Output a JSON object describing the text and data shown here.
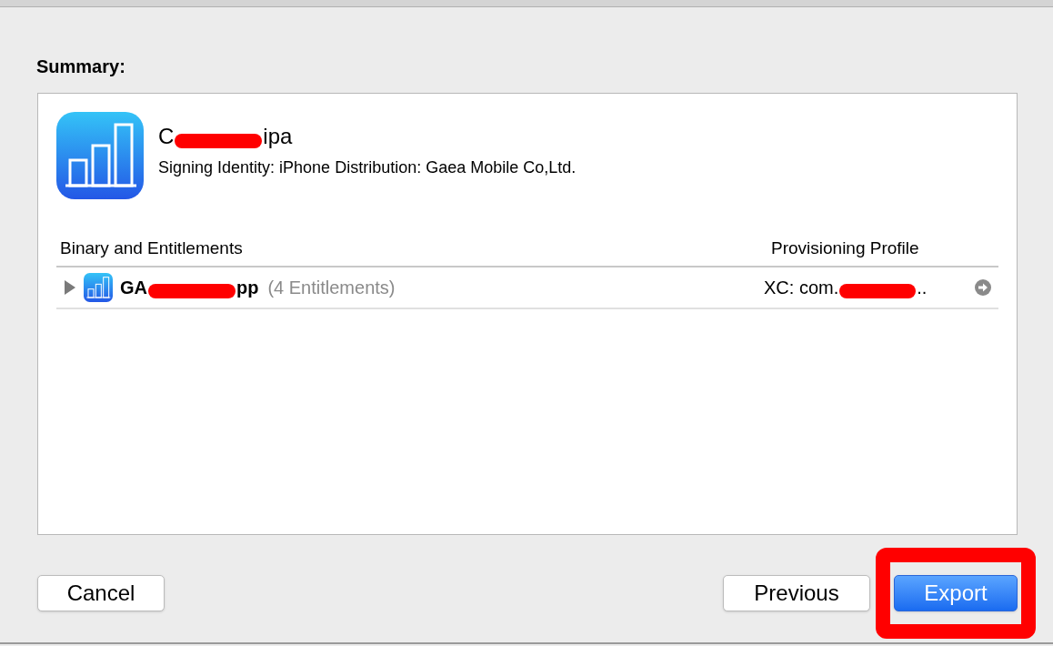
{
  "summary": {
    "heading": "Summary:",
    "archive": {
      "name_start": "C",
      "name_end": "ipa",
      "redacted": true,
      "signing_identity": "Signing Identity: iPhone Distribution: Gaea Mobile Co,Ltd."
    },
    "table": {
      "columns": [
        "Binary and Entitlements",
        "Provisioning Profile"
      ],
      "rows": [
        {
          "expanded": false,
          "binary_start": "GA",
          "binary_end": "pp",
          "redacted": true,
          "entitlements": "(4 Entitlements)",
          "profile_start": "XC: com.",
          "profile_end": "..",
          "profile_redacted": true
        }
      ]
    }
  },
  "buttons": [
    {
      "label": "Cancel",
      "kind": "plain",
      "highlighted": false
    },
    {
      "label": "Previous",
      "kind": "plain",
      "highlighted": false
    },
    {
      "label": "Export",
      "kind": "default",
      "highlighted": true
    }
  ]
}
